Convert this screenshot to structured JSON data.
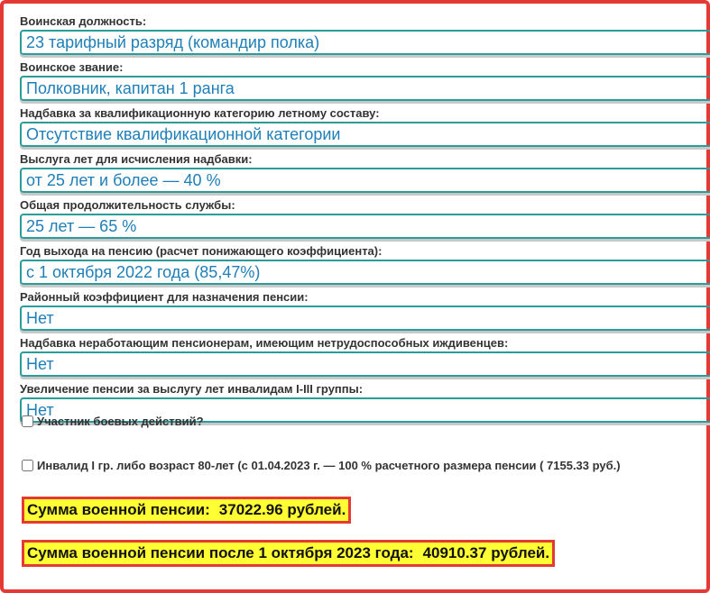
{
  "fields": [
    {
      "label": "Воинская должность:",
      "value": "23 тарифный разряд (командир полка)"
    },
    {
      "label": "Воинское звание:",
      "value": "Полковник, капитан 1 ранга"
    },
    {
      "label": "Надбавка за квалификационную категорию летному составу:",
      "value": "Отсутствие квалификационной категории"
    },
    {
      "label": "Выслуга лет для исчисления надбавки:",
      "value": "от 25 лет и более — 40 %"
    },
    {
      "label": "Общая продолжительность службы:",
      "value": "25 лет — 65 %"
    },
    {
      "label": "Год выхода на пенсию (расчет понижающего коэффициента):",
      "value": "с 1 октября 2022 года (85,47%)"
    },
    {
      "label": "Районный коэффициент для назначения пенсии:",
      "value": "Нет"
    },
    {
      "label": "Надбавка неработающим пенсионерам, имеющим нетрудоспособных иждивенцев:",
      "value": "Нет"
    },
    {
      "label": "Увеличение пенсии за выслугу лет инвалидам I-III группы:",
      "value": "Нет"
    }
  ],
  "checkboxes": {
    "combat": {
      "label": "Участник боевых действий?",
      "checked": false
    },
    "invalid": {
      "label": "Инвалид I гр. либо возраст 80-лет (с 01.04.2023 г. — 100 % расчетного размера пенсии ( 7155.33 руб.)",
      "checked": false
    }
  },
  "results": {
    "pension": {
      "label": "Сумма военной пенсии:",
      "value": "37022.96 рублей."
    },
    "pension_after": {
      "label": "Сумма военной пенсии после 1 октября 2023 года:",
      "value": "40910.37 рублей."
    }
  },
  "colors": {
    "accent": "#2a9d9a",
    "value_text": "#1e7fb8",
    "frame": "#e53935",
    "highlight": "#ffff33"
  }
}
